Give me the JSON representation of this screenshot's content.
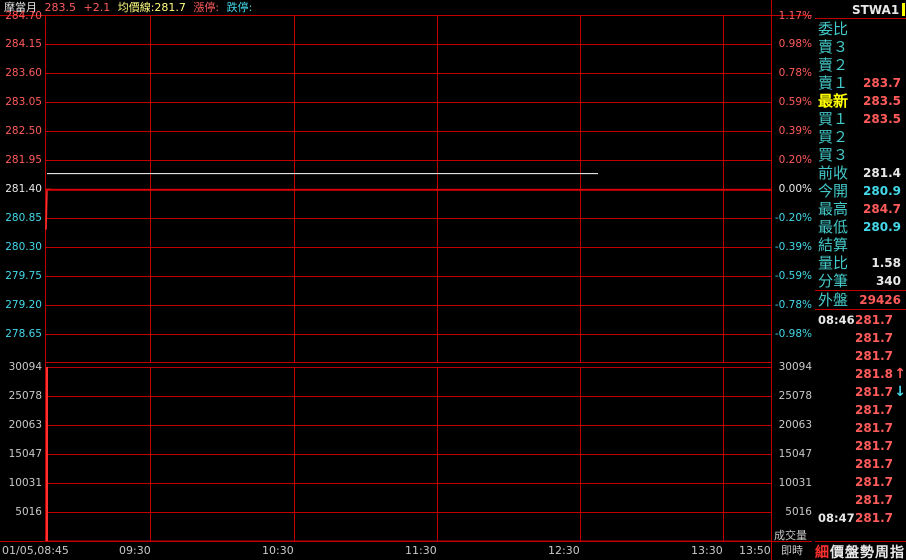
{
  "header": {
    "name": "摩當月",
    "price": "283.5",
    "change": "+2.1",
    "avg_label": "均價線:281.7",
    "limit_up": "漲停:",
    "limit_down": "跌停:"
  },
  "price_axis": {
    "left": [
      "284.70",
      "284.15",
      "283.60",
      "283.05",
      "282.50",
      "281.95",
      "281.40",
      "280.85",
      "280.30",
      "279.75",
      "279.20",
      "278.65"
    ],
    "right": [
      "1.17%",
      "0.98%",
      "0.78%",
      "0.59%",
      "0.39%",
      "0.20%",
      "0.00%",
      "-0.20%",
      "-0.39%",
      "-0.59%",
      "-0.78%",
      "-0.98%"
    ]
  },
  "volume_axis": {
    "left": [
      "30094",
      "25078",
      "20063",
      "15047",
      "10031",
      "5016"
    ],
    "right": [
      "30094",
      "25078",
      "20063",
      "15047",
      "10031",
      "5016"
    ],
    "unit_label": "成交量"
  },
  "time_axis": {
    "labels": [
      "01/05,08:45",
      "09:30",
      "10:30",
      "11:30",
      "12:30",
      "13:30",
      "13:50"
    ],
    "realtime_label": "即時"
  },
  "chart_data": {
    "type": "line",
    "title": "摩當月",
    "ylim": [
      278.65,
      284.7
    ],
    "reference_price": 281.4,
    "series": [
      {
        "name": "price",
        "x": [
          "08:45",
          "08:45",
          "08:46",
          "08:47"
        ],
        "values": [
          280.9,
          281.4,
          281.4,
          281.4
        ]
      },
      {
        "name": "均價線",
        "x": [
          "08:45",
          "12:30"
        ],
        "values": [
          281.7,
          281.7
        ]
      }
    ],
    "volume": {
      "ylim": [
        0,
        30094
      ],
      "x": [
        "08:45"
      ],
      "values": [
        30094
      ]
    },
    "grid": true
  },
  "panel": {
    "symbol": "STWA1",
    "rows": [
      {
        "label": "委比",
        "value": "",
        "color": "#44c8c8"
      },
      {
        "label": "賣３",
        "value": "",
        "color": "#44c8c8"
      },
      {
        "label": "賣２",
        "value": "",
        "color": "#44c8c8"
      },
      {
        "label": "賣１",
        "value": "283.7",
        "color": "#ff5b5b"
      },
      {
        "label": "最新",
        "value": "283.5",
        "color": "#ff5b5b",
        "highlight": true
      },
      {
        "label": "買１",
        "value": "283.5",
        "color": "#ff5b5b"
      },
      {
        "label": "買２",
        "value": "",
        "color": "#44c8c8"
      },
      {
        "label": "買３",
        "value": "",
        "color": "#44c8c8"
      },
      {
        "label": "前收",
        "value": "281.4",
        "color": "#e8e8e8"
      },
      {
        "label": "今開",
        "value": "280.9",
        "color": "#44d8e8"
      },
      {
        "label": "最高",
        "value": "284.7",
        "color": "#ff5b5b"
      },
      {
        "label": "最低",
        "value": "280.9",
        "color": "#44d8e8"
      },
      {
        "label": "結算",
        "value": "",
        "color": "#44c8c8"
      },
      {
        "label": "量比",
        "value": "1.58",
        "color": "#e8e8e8"
      },
      {
        "label": "分筆",
        "value": "340",
        "color": "#e8e8e8"
      }
    ],
    "outer": {
      "label": "外盤",
      "value": "29426"
    },
    "ticks": [
      {
        "time": "08:46",
        "price": "281.7",
        "arrow": ""
      },
      {
        "time": "",
        "price": "281.7",
        "arrow": ""
      },
      {
        "time": "",
        "price": "281.7",
        "arrow": ""
      },
      {
        "time": "",
        "price": "281.8",
        "arrow": "↑"
      },
      {
        "time": "",
        "price": "281.7",
        "arrow": "↓"
      },
      {
        "time": "",
        "price": "281.7",
        "arrow": ""
      },
      {
        "time": "",
        "price": "281.7",
        "arrow": ""
      },
      {
        "time": "",
        "price": "281.7",
        "arrow": ""
      },
      {
        "time": "",
        "price": "281.7",
        "arrow": ""
      },
      {
        "time": "",
        "price": "281.7",
        "arrow": ""
      },
      {
        "time": "",
        "price": "281.7",
        "arrow": ""
      },
      {
        "time": "08:47",
        "price": "281.7",
        "arrow": ""
      }
    ],
    "tabs": [
      "細",
      "價",
      "盤",
      "勢",
      "周",
      "指"
    ]
  },
  "colors": {
    "grid": "#c00000",
    "price_line": "#ff3030",
    "avg_line": "#ffffff",
    "up": "#ff5b5b",
    "down": "#44d8e8",
    "label_cyan": "#44c8c8",
    "highlight": "#ffff00"
  }
}
